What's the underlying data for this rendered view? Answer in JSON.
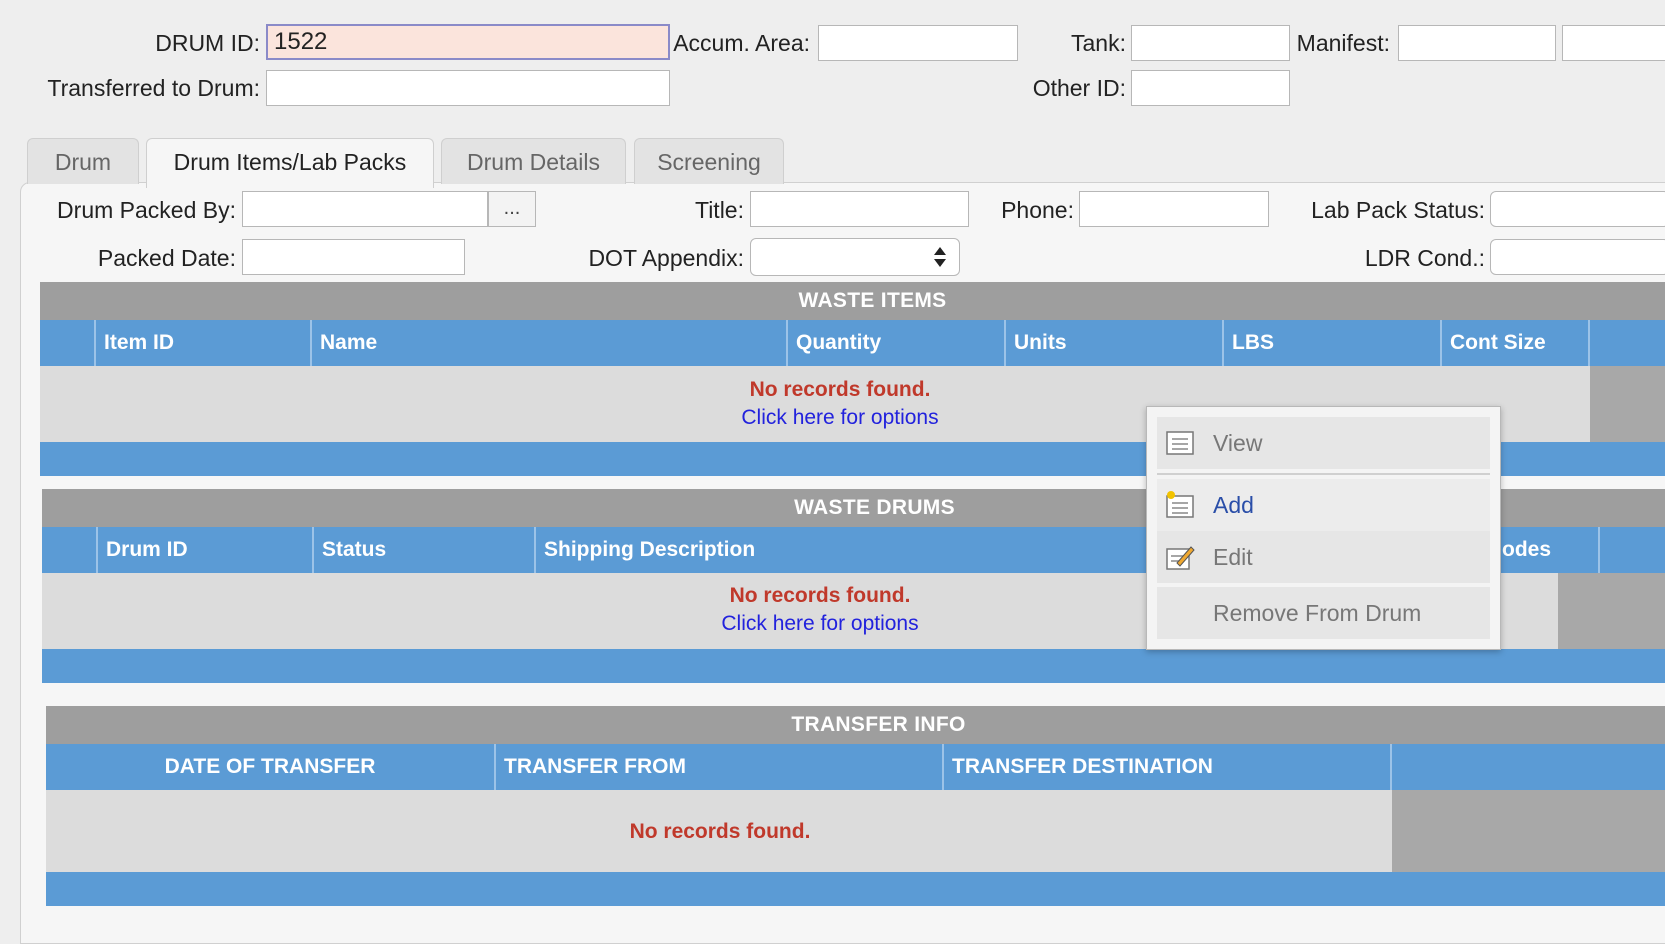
{
  "header": {
    "drum_id_label": "DRUM ID:",
    "drum_id_value": "1522",
    "accum_area_label": "Accum. Area:",
    "tank_label": "Tank:",
    "manifest_label": "Manifest:",
    "transferred_label": "Transferred to Drum:",
    "other_id_label": "Other ID:"
  },
  "tabs": [
    {
      "label": "Drum"
    },
    {
      "label": "Drum Items/Lab Packs"
    },
    {
      "label": "Drum Details"
    },
    {
      "label": "Screening"
    }
  ],
  "form": {
    "packed_by_label": "Drum Packed By:",
    "browse_label": "...",
    "title_label": "Title:",
    "phone_label": "Phone:",
    "lab_pack_status_label": "Lab Pack Status:",
    "packed_date_label": "Packed Date:",
    "dot_appendix_label": "DOT Appendix:",
    "ldr_cond_label": "LDR Cond.:"
  },
  "waste_items": {
    "title": "WASTE ITEMS",
    "columns": [
      "Item ID",
      "Name",
      "Quantity",
      "Units",
      "LBS",
      "Cont Size"
    ],
    "no_records": "No records found.",
    "options_link": "Click here for options"
  },
  "waste_drums": {
    "title": "WASTE DRUMS",
    "columns": [
      "Drum ID",
      "Status",
      "Shipping Description",
      "odes"
    ],
    "no_records": "No records found.",
    "options_link": "Click here for options"
  },
  "transfer_info": {
    "title": "TRANSFER INFO",
    "columns": [
      "DATE OF TRANSFER",
      "TRANSFER FROM",
      "TRANSFER DESTINATION"
    ],
    "no_records": "No records found."
  },
  "context_menu": {
    "items": [
      {
        "label": "View",
        "icon": "list-icon"
      },
      {
        "label": "Add",
        "icon": "add-list-icon"
      },
      {
        "label": "Edit",
        "icon": "edit-icon"
      },
      {
        "label": "Remove From Drum",
        "icon": ""
      }
    ]
  },
  "colors": {
    "header_blue": "#5b9bd5",
    "section_gray": "#9e9e9e",
    "focus_field": "#fbe4dc",
    "no_records_red": "#c0392b",
    "link_blue": "#2222dd"
  }
}
